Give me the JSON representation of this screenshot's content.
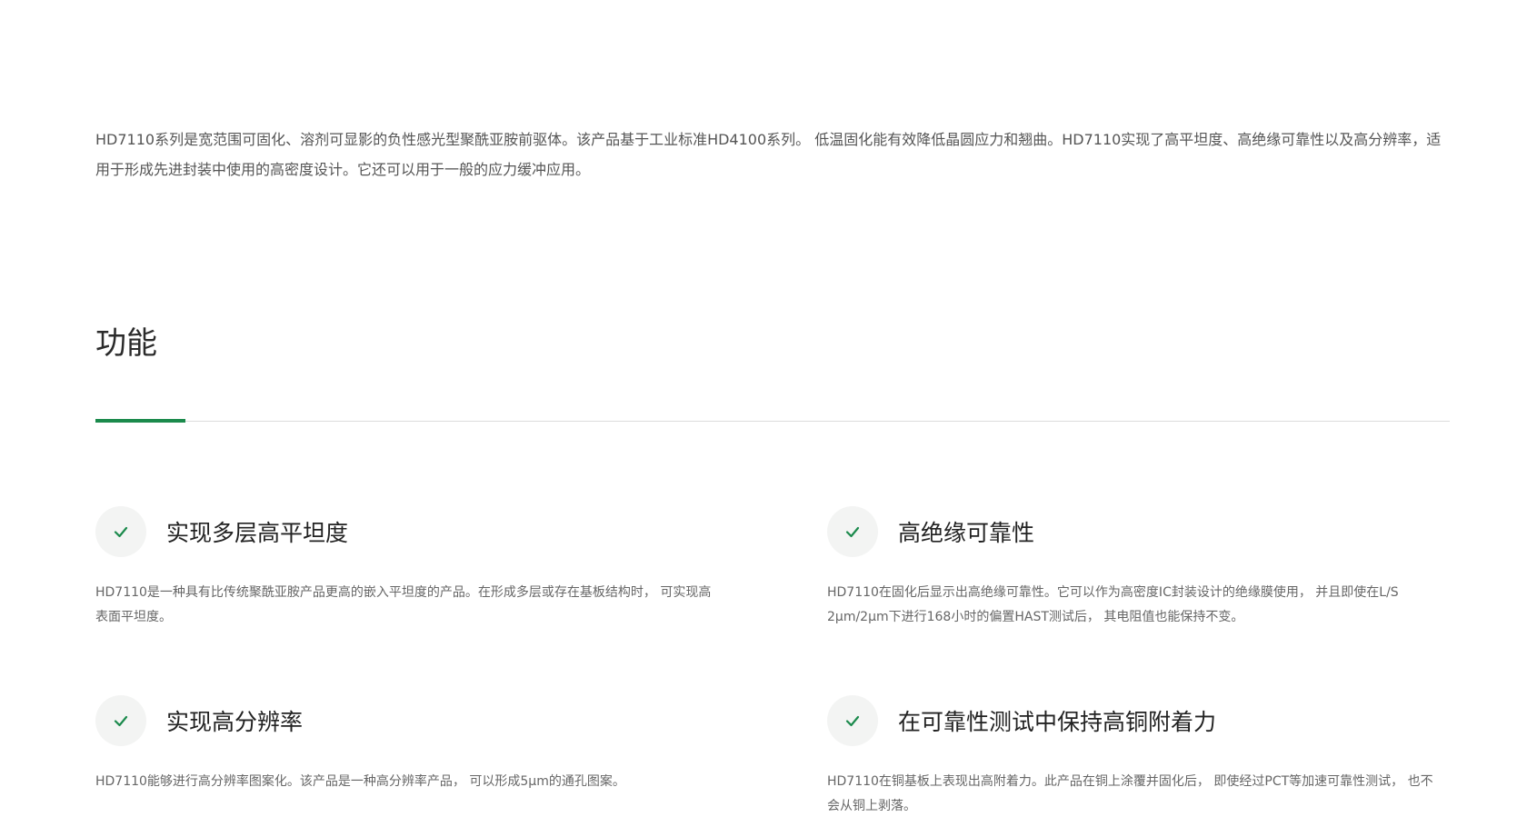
{
  "intro": {
    "text": "HD7110系列是宽范围可固化、溶剂可显影的负性感光型聚酰亚胺前驱体。该产品基于工业标准HD4100系列。 低温固化能有效降低晶圆应力和翘曲。HD7110实现了高平坦度、高绝缘可靠性以及高分辨率，适用于形成先进封装中使用的高密度设计。它还可以用于一般的应力缓冲应用。"
  },
  "section": {
    "title": "功能"
  },
  "colors": {
    "accent": "#1b8a4c",
    "divider": "#dddddd",
    "badge_bg": "#f3f4f3"
  },
  "features": [
    {
      "icon": "check-icon",
      "title": "实现多层高平坦度",
      "desc": "HD7110是一种具有比传统聚酰亚胺产品更高的嵌入平坦度的产品。在形成多层或存在基板结构时， 可实现高表面平坦度。"
    },
    {
      "icon": "check-icon",
      "title": "高绝缘可靠性",
      "desc": "HD7110在固化后显示出高绝缘可靠性。它可以作为高密度IC封装设计的绝缘膜使用， 并且即使在L/S 2μm/2μm下进行168小时的偏置HAST测试后， 其电阻值也能保持不变。"
    },
    {
      "icon": "check-icon",
      "title": "实现高分辨率",
      "desc": "HD7110能够进行高分辨率图案化。该产品是一种高分辨率产品， 可以形成5μm的通孔图案。"
    },
    {
      "icon": "check-icon",
      "title": "在可靠性测试中保持高铜附着力",
      "desc": "HD7110在铜基板上表现出高附着力。此产品在铜上涂覆并固化后， 即使经过PCT等加速可靠性测试， 也不会从铜上剥落。"
    }
  ]
}
